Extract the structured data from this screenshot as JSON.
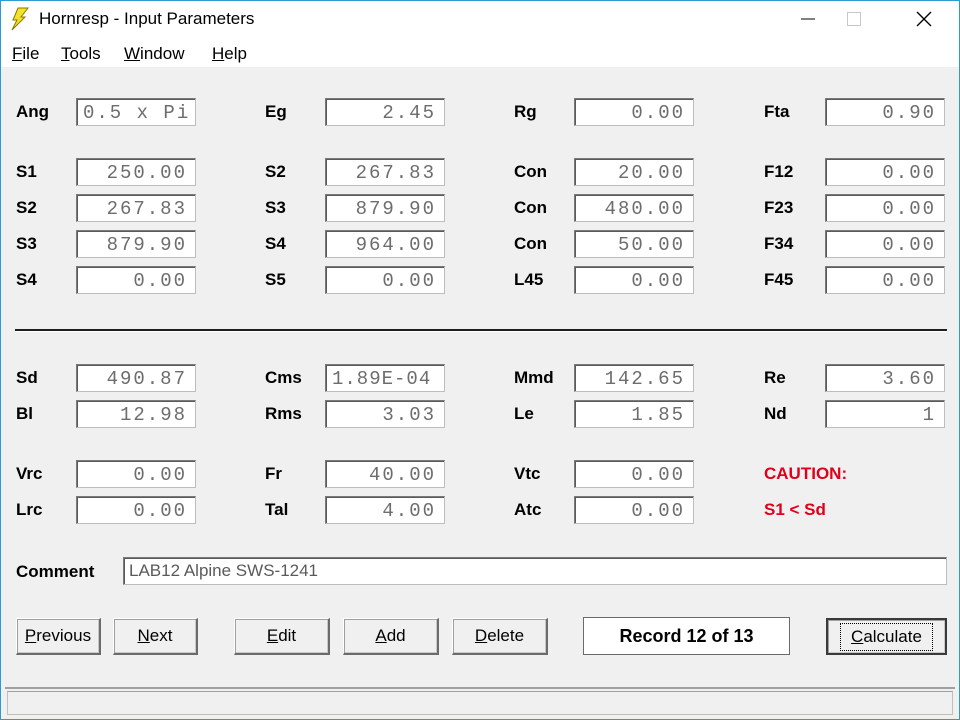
{
  "window": {
    "title": "Hornresp - Input Parameters",
    "icon": "lightning-bolt-icon",
    "controls": [
      "minimize-icon",
      "maximize-icon",
      "close-icon"
    ]
  },
  "menu": {
    "items": [
      {
        "label": "File",
        "accel": "F",
        "rest": "ile"
      },
      {
        "label": "Tools",
        "accel": "T",
        "rest": "ools"
      },
      {
        "label": "Window",
        "accel": "W",
        "rest": "indow"
      },
      {
        "label": "Help",
        "accel": "H",
        "rest": "elp"
      }
    ]
  },
  "horn": {
    "row0": [
      {
        "label": "Ang",
        "value": "0.5 x Pi"
      },
      {
        "label": "Eg",
        "value": "2.45"
      },
      {
        "label": "Rg",
        "value": "0.00"
      },
      {
        "label": "Fta",
        "value": "0.90"
      }
    ],
    "rows": [
      [
        {
          "label": "S1",
          "value": "250.00"
        },
        {
          "label": "S2",
          "value": "267.83"
        },
        {
          "label": "Con",
          "value": "20.00"
        },
        {
          "label": "F12",
          "value": "0.00"
        }
      ],
      [
        {
          "label": "S2",
          "value": "267.83"
        },
        {
          "label": "S3",
          "value": "879.90"
        },
        {
          "label": "Con",
          "value": "480.00"
        },
        {
          "label": "F23",
          "value": "0.00"
        }
      ],
      [
        {
          "label": "S3",
          "value": "879.90"
        },
        {
          "label": "S4",
          "value": "964.00"
        },
        {
          "label": "Con",
          "value": "50.00"
        },
        {
          "label": "F34",
          "value": "0.00"
        }
      ],
      [
        {
          "label": "S4",
          "value": "0.00"
        },
        {
          "label": "S5",
          "value": "0.00"
        },
        {
          "label": "L45",
          "value": "0.00"
        },
        {
          "label": "F45",
          "value": "0.00"
        }
      ]
    ]
  },
  "driver": {
    "rows": [
      [
        {
          "label": "Sd",
          "value": "490.87"
        },
        {
          "label": "Cms",
          "value": "1.89E-04"
        },
        {
          "label": "Mmd",
          "value": "142.65"
        },
        {
          "label": "Re",
          "value": "3.60"
        }
      ],
      [
        {
          "label": "Bl",
          "value": "12.98"
        },
        {
          "label": "Rms",
          "value": "3.03"
        },
        {
          "label": "Le",
          "value": "1.85"
        },
        {
          "label": "Nd",
          "value": "1"
        }
      ]
    ]
  },
  "chamber": {
    "rows": [
      [
        {
          "label": "Vrc",
          "value": "0.00"
        },
        {
          "label": "Fr",
          "value": "40.00"
        },
        {
          "label": "Vtc",
          "value": "0.00"
        }
      ],
      [
        {
          "label": "Lrc",
          "value": "0.00"
        },
        {
          "label": "Tal",
          "value": "4.00"
        },
        {
          "label": "Atc",
          "value": "0.00"
        }
      ]
    ],
    "caution_title": "CAUTION:",
    "caution_text": "S1 < Sd",
    "caution_color": "#e0001b"
  },
  "comment": {
    "label": "Comment",
    "value": "LAB12 Alpine SWS-1241"
  },
  "buttons": {
    "previous": {
      "accel": "P",
      "rest": "revious"
    },
    "next": {
      "accel": "N",
      "rest": "ext"
    },
    "edit": {
      "accel": "E",
      "rest": "dit"
    },
    "add": {
      "accel": "A",
      "rest": "dd"
    },
    "delete": {
      "accel": "D",
      "rest": "elete"
    },
    "calculate": {
      "accel": "C",
      "rest": "alculate"
    }
  },
  "record": {
    "text": "Record 12 of 13"
  },
  "status": {
    "text": ""
  }
}
